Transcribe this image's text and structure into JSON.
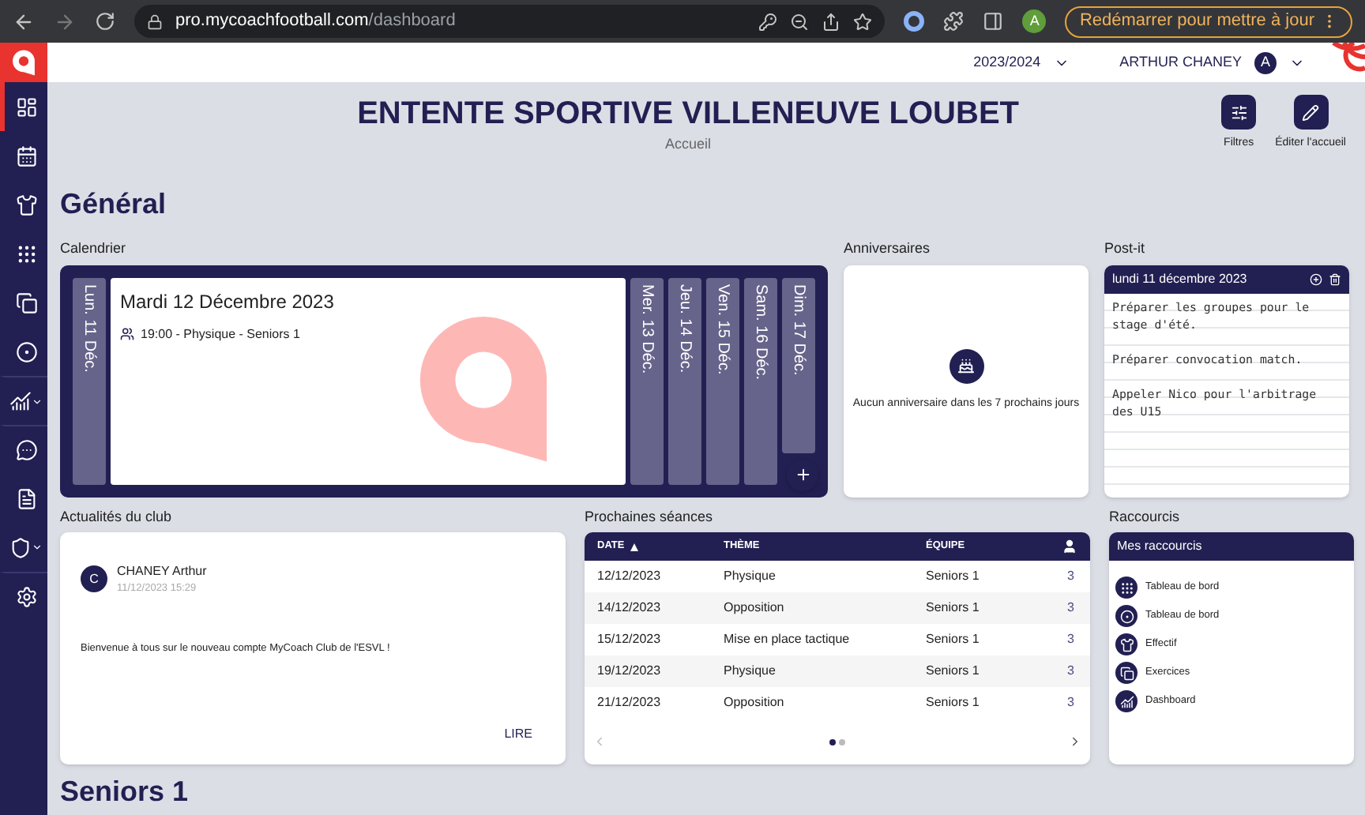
{
  "browser": {
    "url_host": "pro.mycoachfootball.com",
    "url_path": "/dashboard",
    "profile": "A",
    "update_button": "Redémarrer pour mettre à jour"
  },
  "header": {
    "season": "2023/2024",
    "user": "ARTHUR CHANEY",
    "avatar": "A"
  },
  "sidebar": {
    "items": [
      {
        "kind": "dashboard",
        "selected": true,
        "expandable": false
      },
      {
        "kind": "calendar",
        "selected": false,
        "expandable": false
      },
      {
        "kind": "shirt",
        "selected": false,
        "expandable": false
      },
      {
        "kind": "grid",
        "selected": false,
        "expandable": false
      },
      {
        "kind": "files",
        "selected": false,
        "expandable": false
      },
      {
        "kind": "ball",
        "selected": false,
        "expandable": false
      },
      {
        "kind": "chart",
        "selected": false,
        "expandable": true
      },
      {
        "kind": "chat",
        "selected": false,
        "expandable": false
      },
      {
        "kind": "document",
        "selected": false,
        "expandable": false
      },
      {
        "kind": "shield",
        "selected": false,
        "expandable": true
      },
      {
        "kind": "settings",
        "selected": false,
        "expandable": false
      }
    ]
  },
  "page": {
    "title": "ENTENTE SPORTIVE VILLENEUVE LOUBET",
    "subtitle": "Accueil",
    "actions": [
      {
        "kind": "filters",
        "label": "Filtres"
      },
      {
        "kind": "edit",
        "label": "Éditer l'accueil"
      }
    ]
  },
  "section_title": "Général",
  "calendar": {
    "title": "Calendrier",
    "days": [
      {
        "label": "Lun. 11 Déc.",
        "selected": false
      },
      {
        "label": "Mardi 12 Décembre 2023",
        "selected": true,
        "events": [
          "19:00 - Physique - Seniors 1"
        ]
      },
      {
        "label": "Mer. 13 Déc.",
        "selected": false
      },
      {
        "label": "Jeu. 14 Déc.",
        "selected": false
      },
      {
        "label": "Ven. 15 Déc.",
        "selected": false
      },
      {
        "label": "Sam. 16 Déc.",
        "selected": false
      },
      {
        "label": "Dim. 17 Déc.",
        "selected": false
      }
    ]
  },
  "anniversaries": {
    "title": "Anniversaires",
    "empty_text": "Aucun anniversaire dans les 7 prochains jours"
  },
  "postit": {
    "title": "Post-it",
    "date": "lundi 11 décembre 2023",
    "notes": [
      "Préparer les groupes pour le stage d'été.",
      "Préparer convocation match.",
      "Appeler Nico pour l'arbitrage des U15"
    ]
  },
  "news": {
    "title": "Actualités du club",
    "avatar": "C",
    "author": "CHANEY Arthur",
    "date": "11/12/2023 15:29",
    "body": "Bienvenue à tous sur le nouveau compte MyCoach Club de l'ESVL !",
    "action": "LIRE"
  },
  "sessions": {
    "title": "Prochaines séances",
    "columns": [
      {
        "kind": "text",
        "label": "DATE",
        "sorted": true
      },
      {
        "kind": "text",
        "label": "THÈME",
        "sorted": false
      },
      {
        "kind": "text",
        "label": "ÉQUIPE",
        "sorted": false
      },
      {
        "kind": "icon"
      }
    ],
    "rows": [
      [
        "12/12/2023",
        "Physique",
        "Seniors 1",
        "3"
      ],
      [
        "14/12/2023",
        "Opposition",
        "Seniors 1",
        "3"
      ],
      [
        "15/12/2023",
        "Mise en place tactique",
        "Seniors 1",
        "3"
      ],
      [
        "19/12/2023",
        "Physique",
        "Seniors 1",
        "3"
      ],
      [
        "21/12/2023",
        "Opposition",
        "Seniors 1",
        "3"
      ]
    ],
    "pages": [
      {
        "selected": true
      },
      {
        "selected": false
      }
    ]
  },
  "shortcuts": {
    "title": "Raccourcis",
    "header": "Mes raccourcis",
    "items": [
      {
        "kind": "grid",
        "label": "Tableau de bord"
      },
      {
        "kind": "ball",
        "label": "Tableau de bord"
      },
      {
        "kind": "shirt",
        "label": "Effectif"
      },
      {
        "kind": "files",
        "label": "Exercices"
      },
      {
        "kind": "chart",
        "label": "Dashboard"
      }
    ]
  },
  "section2_title": "Seniors 1"
}
